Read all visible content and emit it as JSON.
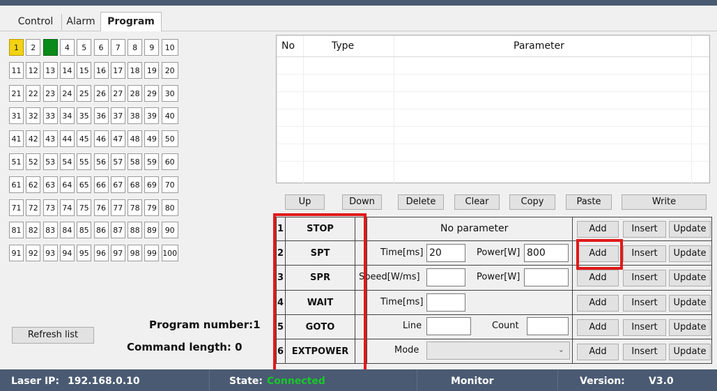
{
  "tabs": [
    "Control",
    "Alarm",
    "Program"
  ],
  "grid": [
    "1",
    "2",
    "3",
    "4",
    "5",
    "6",
    "7",
    "8",
    "9",
    "10",
    "11",
    "12",
    "13",
    "14",
    "15",
    "16",
    "17",
    "18",
    "19",
    "20",
    "21",
    "22",
    "23",
    "24",
    "25",
    "26",
    "27",
    "28",
    "29",
    "30",
    "31",
    "32",
    "33",
    "34",
    "35",
    "36",
    "37",
    "38",
    "39",
    "40",
    "41",
    "42",
    "43",
    "44",
    "45",
    "46",
    "47",
    "48",
    "49",
    "50",
    "51",
    "52",
    "53",
    "54",
    "55",
    "56",
    "57",
    "58",
    "59",
    "60",
    "61",
    "62",
    "63",
    "64",
    "65",
    "66",
    "67",
    "68",
    "69",
    "70",
    "71",
    "72",
    "73",
    "74",
    "75",
    "76",
    "77",
    "78",
    "79",
    "80",
    "81",
    "82",
    "83",
    "84",
    "85",
    "86",
    "87",
    "88",
    "89",
    "90",
    "91",
    "92",
    "93",
    "94",
    "95",
    "96",
    "97",
    "98",
    "99",
    "100"
  ],
  "grid_selected": "1",
  "grid_active": "3",
  "refresh_label": "Refresh list",
  "program_number": "Program number:1",
  "command_length": "Command length:  0",
  "list_headers": {
    "no": "No",
    "type": "Type",
    "parameter": "Parameter"
  },
  "list_buttons": [
    "Up",
    "Down",
    "Delete",
    "Clear",
    "Copy",
    "Paste",
    "Write"
  ],
  "commands": [
    {
      "num": "1",
      "name": "STOP"
    },
    {
      "num": "2",
      "name": "SPT"
    },
    {
      "num": "3",
      "name": "SPR"
    },
    {
      "num": "4",
      "name": "WAIT"
    },
    {
      "num": "5",
      "name": "GOTO"
    },
    {
      "num": "6",
      "name": "EXTPOWER"
    }
  ],
  "params": {
    "no_parameter": "No parameter",
    "time_ms": "Time[ms]",
    "power_w": "Power[W]",
    "speed": "Speed[W/ms]",
    "line": "Line",
    "count": "Count",
    "mode": "Mode",
    "spt_time_value": "20",
    "spt_power_value": "800"
  },
  "row_actions": {
    "add": "Add",
    "insert": "Insert",
    "update": "Update"
  },
  "status": {
    "ip_label": "Laser IP:",
    "ip_value": "192.168.0.10",
    "state_label": "State:",
    "state_value": "Connected",
    "monitor": "Monitor",
    "version_label": "Version:",
    "version_value": "V3.0"
  },
  "colors": {
    "status_bar": "#4a5a73",
    "connected": "#19c62a",
    "highlight": "#e01a1a",
    "selected": "#f2d211",
    "active": "#0a8a19"
  }
}
